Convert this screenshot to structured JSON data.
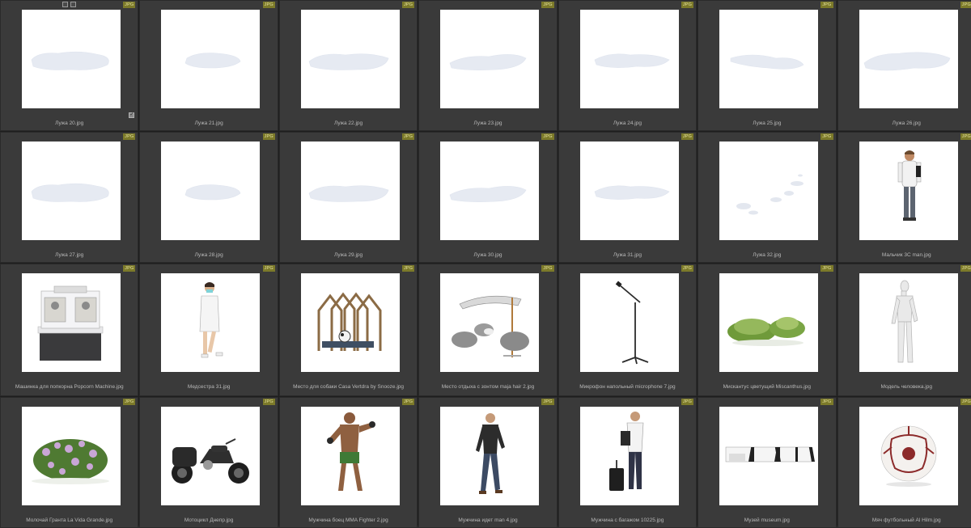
{
  "colors": {
    "background": "#2b2b2b",
    "cell": "#3a3a3a",
    "badge": "#7c7a2a",
    "label": "#b8b8b8"
  },
  "items": [
    {
      "name": "Лужа 20.jpg",
      "badge": "JPG",
      "icon": "puddle-image"
    },
    {
      "name": "Лужа 21.jpg",
      "badge": "JPG",
      "icon": "puddle-image"
    },
    {
      "name": "Лужа 22.jpg",
      "badge": "JPG",
      "icon": "puddle-image"
    },
    {
      "name": "Лужа 23.jpg",
      "badge": "JPG",
      "icon": "puddle-image"
    },
    {
      "name": "Лужа 24.jpg",
      "badge": "JPG",
      "icon": "puddle-image"
    },
    {
      "name": "Лужа 25.jpg",
      "badge": "JPG",
      "icon": "puddle-image"
    },
    {
      "name": "Лужа 26.jpg",
      "badge": "JPG",
      "icon": "puddle-image"
    },
    {
      "name": "Лужа 27.jpg",
      "badge": "JPG",
      "icon": "puddle-image"
    },
    {
      "name": "Лужа 28.jpg",
      "badge": "JPG",
      "icon": "puddle-image"
    },
    {
      "name": "Лужа 29.jpg",
      "badge": "JPG",
      "icon": "puddle-image"
    },
    {
      "name": "Лужа 30.jpg",
      "badge": "JPG",
      "icon": "puddle-image"
    },
    {
      "name": "Лужа 31.jpg",
      "badge": "JPG",
      "icon": "puddle-image"
    },
    {
      "name": "Лужа 32.jpg",
      "badge": "JPG",
      "icon": "puddles-image"
    },
    {
      "name": "Мальчик 3C man.jpg",
      "badge": "JPG",
      "icon": "boy-image"
    },
    {
      "name": "Машинка для попкорна Popcorn Machine.jpg",
      "badge": "JPG",
      "icon": "popcorn-machine-image"
    },
    {
      "name": "Медсестра 31.jpg",
      "badge": "JPG",
      "icon": "nurse-image"
    },
    {
      "name": "Место для собаки Casa Vertdra by Snooze.jpg",
      "badge": "JPG",
      "icon": "dog-house-image"
    },
    {
      "name": "Место отдыха с зонтом maja hair 2.jpg",
      "badge": "JPG",
      "icon": "lounge-umbrella-image"
    },
    {
      "name": "Микрофон напольный microphone 7.jpg",
      "badge": "JPG",
      "icon": "microphone-stand-image"
    },
    {
      "name": "Мискантус цветущий Miscanthus.jpg",
      "badge": "JPG",
      "icon": "grass-image"
    },
    {
      "name": "Модель человека.jpg",
      "badge": "JPG",
      "icon": "mannequin-image"
    },
    {
      "name": "Молочай Гранта La Vida Grande.jpg",
      "badge": "JPG",
      "icon": "shrub-image"
    },
    {
      "name": "Мотоцикл Днепр.jpg",
      "badge": "JPG",
      "icon": "motorcycle-image"
    },
    {
      "name": "Мужчина боец MMA Fighter 2.jpg",
      "badge": "JPG",
      "icon": "fighter-image"
    },
    {
      "name": "Мужчина идет man 4.jpg",
      "badge": "JPG",
      "icon": "walking-man-image"
    },
    {
      "name": "Мужчина с багажом 10225.jpg",
      "badge": "JPG",
      "icon": "man-luggage-image"
    },
    {
      "name": "Музей museum.jpg",
      "badge": "JPG",
      "icon": "museum-image"
    },
    {
      "name": "Мяч футбольный Al Hilm.jpg",
      "badge": "JPG",
      "icon": "football-image"
    }
  ]
}
